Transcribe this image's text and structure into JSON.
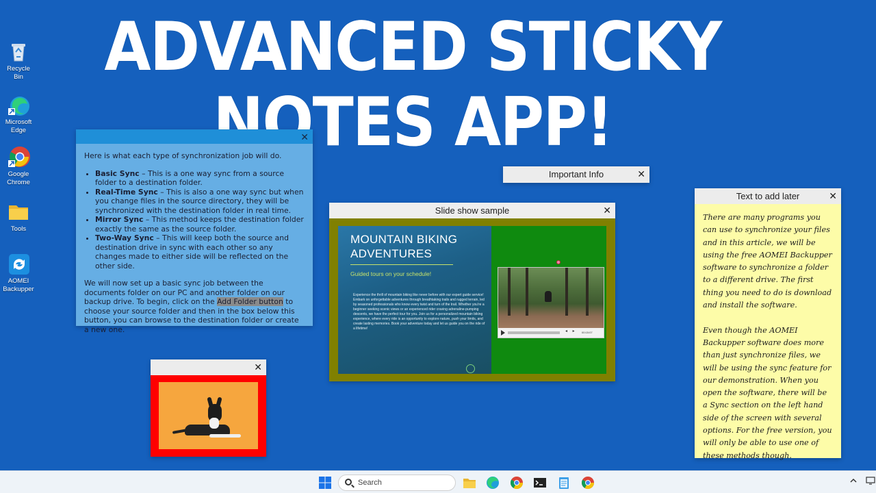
{
  "headline": "ADVANCED STICKY NOTES APP!",
  "desktop_icons": [
    {
      "label": "Recycle Bin",
      "icon": "recycle-bin-icon"
    },
    {
      "label": "Microsoft Edge",
      "icon": "edge-icon"
    },
    {
      "label": "Google Chrome",
      "icon": "chrome-icon"
    },
    {
      "label": "Tools",
      "icon": "folder-icon"
    },
    {
      "label": "AOMEI Backupper",
      "icon": "aomei-icon"
    }
  ],
  "notes": {
    "sync": {
      "bg_color": "#66aee4",
      "intro": "Here is what each type of synchronization job will do.",
      "items": [
        {
          "term": "Basic Sync",
          "desc": " – This is a one way sync from a source folder to a destination folder."
        },
        {
          "term": "Real-Time Sync",
          "desc": " – This is also a one way sync but when you change files in the source directory, they will be synchronized with the destination folder in real time."
        },
        {
          "term": "Mirror Sync",
          "desc": " – This method keeps the destination folder exactly the same as the source folder."
        },
        {
          "term": "Two-Way Sync",
          "desc": " – This will keep both the source and destination drive in sync with each other so any changes made to either side will be reflected on the other side."
        }
      ],
      "outro_before": "We will now set up a basic sync job between the documents folder on our PC and another folder on our backup drive. To begin, click on the ",
      "outro_highlight": "Add Folder button",
      "outro_after": " to choose your source folder and then in the box below this button, you can browse to the destination folder or create a new one."
    },
    "important": {
      "title": "Important Info"
    },
    "slideshow": {
      "title": "Slide show sample",
      "frame_color": "#808000",
      "slide_heading": "MOUNTAIN BIKING ADVENTURES",
      "slide_subheading": "Guided tours on your schedule!",
      "slide_paragraph": "Experience the thrill of mountain biking like never before with our expert guide service! Embark on unforgettable adventures through breathtaking trails and rugged terrain, led by seasoned professionals who know every twist and turn of the trail. Whether you're a beginner seeking scenic views or an experienced rider craving adrenaline-pumping descents, we have the perfect tour for you. Join us for a personalized mountain biking experience, where every ride is an opportunity to explore nature, push your limits, and create lasting memories. Book your adventure today and let us guide you on the ride of a lifetime!",
      "video_time": "00:15:07"
    },
    "dog": {
      "frame_color": "#ff0000"
    },
    "later": {
      "title": "Text to add later",
      "bg_color": "#fdfca8",
      "text": "There are many programs you can use to synchronize your files and in this article, we will be using the free AOMEI Backupper software to synchronize a folder to a different drive. The first thing you need to do is download and install the software.\n\nEven though the AOMEI Backupper software does more than just synchronize files, we will be using the sync feature for our demonstration. When you open the software, there will be a Sync section on the left hand side of the screen with several options. For the free version, you will only be able to use one of these methods though."
    },
    "close_glyph": "✕"
  },
  "taskbar": {
    "search_placeholder": "Search",
    "apps": [
      "start-icon",
      "file-explorer-icon",
      "edge-icon",
      "chrome-icon",
      "terminal-icon",
      "notepad-icon",
      "chrome-icon"
    ],
    "tray": [
      "chevron-up-icon",
      "monitor-icon"
    ]
  }
}
